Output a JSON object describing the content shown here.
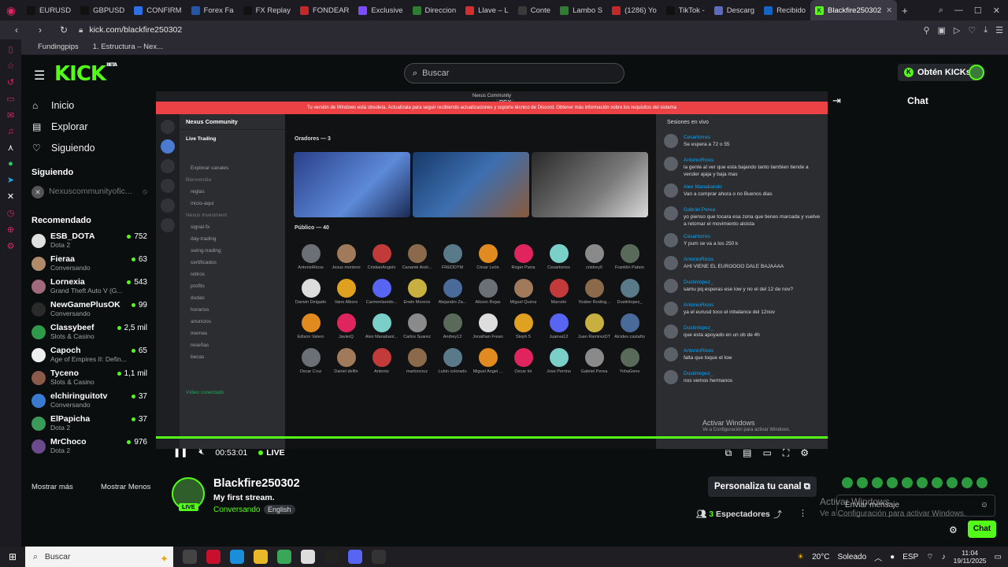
{
  "browser": {
    "tabs": [
      {
        "label": "EURUSD",
        "color": "#111111"
      },
      {
        "label": "GBPUSD",
        "color": "#111111"
      },
      {
        "label": "CONFIRM",
        "color": "#2f6fe4"
      },
      {
        "label": "Forex Fa",
        "color": "#2456a8"
      },
      {
        "label": "FX Replay",
        "color": "#111111"
      },
      {
        "label": "FONDEAR",
        "color": "#c62828"
      },
      {
        "label": "Exclusive",
        "color": "#7c4dff"
      },
      {
        "label": "Direccion",
        "color": "#2e7d32"
      },
      {
        "label": "Llave – L",
        "color": "#d32f2f"
      },
      {
        "label": "Conte",
        "color": "#3a3a3a"
      },
      {
        "label": "Lambo S",
        "color": "#2e7d32"
      },
      {
        "label": "(1286) Yo",
        "color": "#c62828"
      },
      {
        "label": "TikTok -",
        "color": "#111111"
      },
      {
        "label": "Descarg",
        "color": "#5c6bc0"
      },
      {
        "label": "Recibido",
        "color": "#1565c0"
      }
    ],
    "active_tab": "Blackfire250302",
    "url": "kick.com/blackfire250302",
    "bookmarks": [
      "Fundingpips",
      "1. Estructura – Nex..."
    ]
  },
  "kick": {
    "logo": "KICK",
    "logo_sup": "BETA",
    "search_placeholder": "Buscar",
    "kicks_button": "Obtén KICKs",
    "nav": [
      {
        "label": "Inicio",
        "icon": "home-icon",
        "glyph": "⌂"
      },
      {
        "label": "Explorar",
        "icon": "browse-icon",
        "glyph": "▤"
      },
      {
        "label": "Siguiendo",
        "icon": "heart-icon",
        "glyph": "♡"
      }
    ],
    "following_title": "Siguiendo",
    "following": [
      {
        "name": "Nexuscommunityofic..."
      }
    ],
    "recommended_title": "Recomendado",
    "recommended": [
      {
        "name": "ESB_DOTA",
        "category": "Dota 2",
        "viewers": "752",
        "color": "#e0e0e0"
      },
      {
        "name": "Fieraa",
        "category": "Conversando",
        "viewers": "63",
        "color": "#b08a6a"
      },
      {
        "name": "Lornexia",
        "category": "Grand Theft Auto V (G...",
        "viewers": "543",
        "color": "#a06a7a"
      },
      {
        "name": "NewGamePlusOK",
        "category": "Conversando",
        "viewers": "99",
        "color": "#2a2a2a"
      },
      {
        "name": "Classybeef",
        "category": "Slots & Casino",
        "viewers": "2,5 mil",
        "color": "#2f9a4a"
      },
      {
        "name": "Capoch",
        "category": "Age of Empires II: Defin...",
        "viewers": "65",
        "color": "#eeeeee"
      },
      {
        "name": "Tyceno",
        "category": "Slots & Casino",
        "viewers": "1,1 mil",
        "color": "#8a5a4a"
      },
      {
        "name": "elchiringuitotv",
        "category": "Conversando",
        "viewers": "37",
        "color": "#3a7ad0"
      },
      {
        "name": "ElPapicha",
        "category": "Dota 2",
        "viewers": "37",
        "color": "#3a9a5a"
      },
      {
        "name": "MrChoco",
        "category": "Dota 2",
        "viewers": "976",
        "color": "#6a4a8a"
      }
    ],
    "show_more": "Mostrar más",
    "show_less": "Mostrar Menos"
  },
  "stream": {
    "window_title": "Nexus Community",
    "window_label": "RGX",
    "banner": "Tu versión de Windows está obsoleta. Actualízala para seguir recibiendo actualizaciones y soporte técnico de Discord. Obtener más información sobre los requisitos del sistema",
    "server_name": "Nexus Community",
    "channel_name": "Live Trading",
    "channels": [
      "Explorar canales",
      "Bienvenida",
      "reglas",
      "inicio-aqui",
      "Nexus Investment",
      "signal-fx",
      "day-trading",
      "swing-trading",
      "certificados",
      "retiros",
      "profits",
      "dudas",
      "horarios",
      "anuncios",
      "memes",
      "reseñas",
      "becas"
    ],
    "voice_status": "Vídeo conectado",
    "speakers_label": "Oradores — 3",
    "public_label": "Público — 40",
    "audience": [
      "AntonioRioss",
      "Jesus montero",
      "CristianAngelo",
      "Canamè Areli...",
      "FREDDYM",
      "César León",
      "Roger Parra",
      "Cesartorres",
      "cristrey0",
      "Franklin Pabon",
      "Darwin Delgado",
      "Vane Albors",
      "Carmenlaredo...",
      "Erwin Moreno",
      "Alejandro Za...",
      "Aikson Rojas",
      "Miguel Quiroz",
      "Marcelo",
      "Yosber Roding...",
      "Dustinlopez_",
      "Edison Valero",
      "JavierQ",
      "Alex Manabant...",
      "Carlos Suarez",
      "Andrey12",
      "Jonathan Frean",
      "Steph 5",
      "Juanva12",
      "Juan RamirezDT",
      "Alcides castaño",
      "Oscar Cruz",
      "Daniel delfin",
      "Antonio",
      "marloncruz",
      "Lubin colorado",
      "Miguel Angel ...",
      "Oscar kir",
      "Jose Perrino",
      "Gabriel Perea",
      "YohaGene"
    ],
    "chat_header": "Sesiones en vivo",
    "messages": [
      {
        "user": "Cesartorres",
        "text": "Se espera a 72 o 55"
      },
      {
        "user": "AntonioRioss",
        "text": "la gente al ver que esta bajando tanto tambien tiende a vender ajaja y baja mas"
      },
      {
        "user": "Alex Manabando",
        "text": "Van a comprar ahora o no Buenos dias"
      },
      {
        "user": "Gabriel Perea",
        "text": "yo pienso que tocara esa zona que tienes marcada y vuelve a retomar el movimiento alcista"
      },
      {
        "user": "Cesartorres",
        "text": "Y pum se va a los 250 k"
      },
      {
        "user": "AntonioRioss",
        "text": "AHI VIENE EL EUROOOO DALE BAJAAAA"
      },
      {
        "user": "Dustinlopez_",
        "text": "samu pq esperas ese low y no el del 12 de nov?"
      },
      {
        "user": "AntonioRioss",
        "text": "ya el eurusd toco el inbalance del 12nov"
      },
      {
        "user": "Dustinlopez_",
        "text": "que esta apoyado en un ob de 4h"
      },
      {
        "user": "AntonioRioss",
        "text": "falta que toque el low"
      },
      {
        "user": "Dustinlopez_",
        "text": "nos vemos hermanos"
      }
    ],
    "activate_line1": "Activar Windows",
    "activate_line2": "Ve a Configuración para activar Windows.",
    "time": "00:53:01",
    "live": "LIVE"
  },
  "channel": {
    "name": "Blackfire250302",
    "title": "My first stream.",
    "category": "Conversando",
    "language": "English",
    "live_badge": "LIVE",
    "customize": "Personaliza tu canal",
    "spectators_count": "3",
    "spectators_label": "Espectadores"
  },
  "chat": {
    "title": "Chat",
    "placeholder": "Enviar mensaje",
    "send": "Chat",
    "watermark1": "Activar Windows",
    "watermark2": "Ve a Configuración para activar Windows."
  },
  "taskbar": {
    "search": "Buscar",
    "weather": "20°C",
    "weather_desc": "Soleado",
    "lang": "ESP",
    "time": "11:04",
    "date": "19/11/2025"
  },
  "colors": {
    "accent": "#53fc18",
    "bg": "#0b0e0f"
  }
}
